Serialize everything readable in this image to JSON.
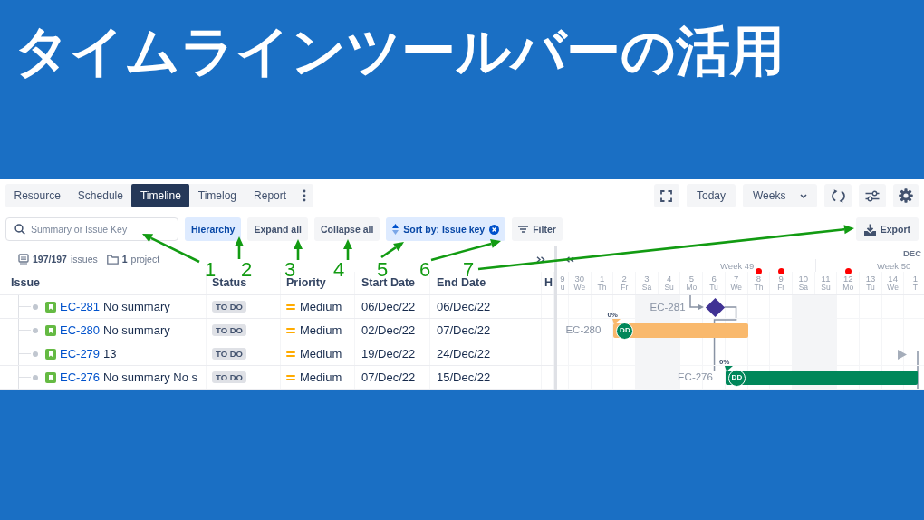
{
  "title": "タイムラインツールバーの活用",
  "app": {
    "tabs": [
      {
        "label": "Resource",
        "selected": false
      },
      {
        "label": "Schedule",
        "selected": false
      },
      {
        "label": "Timeline",
        "selected": true
      },
      {
        "label": "Timelog",
        "selected": false
      },
      {
        "label": "Report",
        "selected": false
      }
    ],
    "today_button": "Today",
    "scale_select": {
      "value": "Weeks"
    },
    "search": {
      "placeholder": "Summary or Issue Key"
    },
    "toolbar": [
      {
        "kind": "toggle",
        "label": "Hierarchy",
        "selected": true
      },
      {
        "kind": "button",
        "label": "Expand all",
        "selected": false
      },
      {
        "kind": "button",
        "label": "Collapse all",
        "selected": false
      },
      {
        "kind": "sort",
        "label": "Sort by: Issue key",
        "selected": true
      },
      {
        "kind": "filter",
        "label": "Filter",
        "selected": false
      }
    ],
    "export_button": "Export",
    "summary": {
      "issues_count": "197/197",
      "issues_label": "issues",
      "projects_count": "1",
      "projects_label": "project"
    },
    "columns": [
      "Issue",
      "Status",
      "Priority",
      "Start Date",
      "End Date",
      "H"
    ],
    "rows": [
      {
        "key": "EC-281",
        "summary": "No summary",
        "status": "TO DO",
        "priority": "Medium",
        "start_date": "06/Dec/22",
        "end_date": "06/Dec/22",
        "timeline": {
          "kind": "milestone",
          "label": "EC-281",
          "color": "#403294"
        }
      },
      {
        "key": "EC-280",
        "summary": "No summary",
        "status": "TO DO",
        "priority": "Medium",
        "start_date": "02/Dec/22",
        "end_date": "07/Dec/22",
        "timeline": {
          "kind": "bar",
          "label": "EC-280",
          "progress": "0%",
          "assignee": "DD",
          "color": "#f9b96d"
        }
      },
      {
        "key": "EC-279",
        "summary": "13",
        "status": "TO DO",
        "priority": "Medium",
        "start_date": "19/Dec/22",
        "end_date": "24/Dec/22",
        "timeline": {
          "kind": "offscreen"
        }
      },
      {
        "key": "EC-276",
        "summary": "No summary No s",
        "status": "TO DO",
        "priority": "Medium",
        "start_date": "07/Dec/22",
        "end_date": "15/Dec/22",
        "timeline": {
          "kind": "bar",
          "label": "EC-276",
          "progress": "0%",
          "assignee": "DD",
          "color": "#00875a"
        }
      }
    ],
    "timeline": {
      "month": "DEC",
      "days": [
        {
          "date": "9",
          "weekday": "u",
          "weekend": false,
          "marked": false
        },
        {
          "date": "30",
          "weekday": "We",
          "weekend": false,
          "marked": false
        },
        {
          "date": "1",
          "weekday": "Th",
          "weekend": false,
          "marked": false
        },
        {
          "date": "2",
          "weekday": "Fr",
          "weekend": false,
          "marked": false
        },
        {
          "date": "3",
          "weekday": "Sa",
          "weekend": true,
          "marked": false
        },
        {
          "date": "4",
          "weekday": "Su",
          "weekend": true,
          "marked": false,
          "week": "Week 49"
        },
        {
          "date": "5",
          "weekday": "Mo",
          "weekend": false,
          "marked": false
        },
        {
          "date": "6",
          "weekday": "Tu",
          "weekend": false,
          "marked": false
        },
        {
          "date": "7",
          "weekday": "We",
          "weekend": false,
          "marked": false
        },
        {
          "date": "8",
          "weekday": "Th",
          "weekend": false,
          "marked": true
        },
        {
          "date": "9",
          "weekday": "Fr",
          "weekend": false,
          "marked": true
        },
        {
          "date": "10",
          "weekday": "Sa",
          "weekend": true,
          "marked": false
        },
        {
          "date": "11",
          "weekday": "Su",
          "weekend": true,
          "marked": false,
          "week": "Week 50"
        },
        {
          "date": "12",
          "weekday": "Mo",
          "weekend": false,
          "marked": true
        },
        {
          "date": "13",
          "weekday": "Tu",
          "weekend": false,
          "marked": false
        },
        {
          "date": "14",
          "weekday": "We",
          "weekend": false,
          "marked": false
        },
        {
          "date": "1",
          "weekday": "T",
          "weekend": false,
          "marked": false
        }
      ]
    }
  },
  "callouts": [
    {
      "number": "1"
    },
    {
      "number": "2"
    },
    {
      "number": "3"
    },
    {
      "number": "4"
    },
    {
      "number": "5"
    },
    {
      "number": "6"
    },
    {
      "number": "7"
    }
  ]
}
